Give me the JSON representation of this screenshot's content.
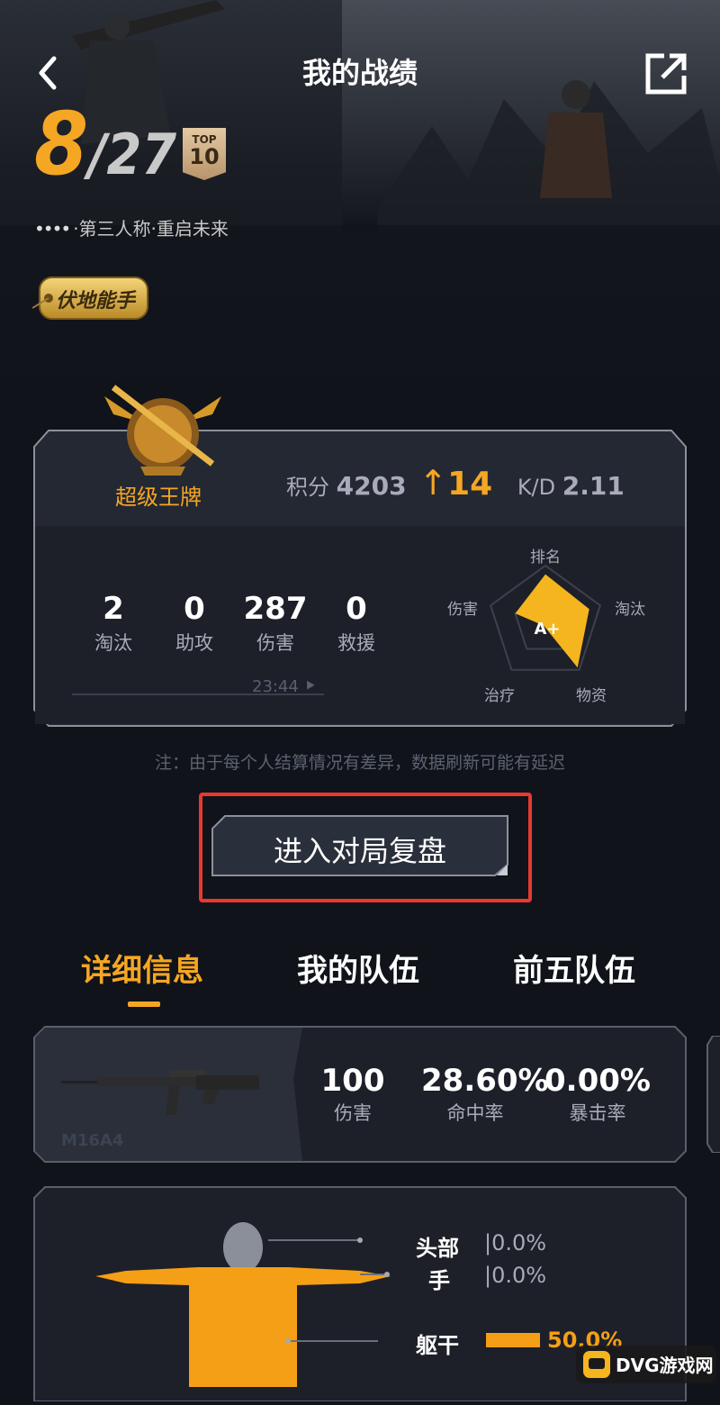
{
  "header": {
    "title": "我的战绩"
  },
  "result": {
    "rank": "8",
    "total": "/27",
    "top_badge_line1": "TOP",
    "top_badge_line2": "10"
  },
  "mode": {
    "icon": "••••",
    "text": "·第三人称·重启未来"
  },
  "title_tag": {
    "label": "伏地能手"
  },
  "tier": {
    "name": "超级王牌"
  },
  "score": {
    "label": "积分",
    "value": "4203",
    "arrow": "↑",
    "delta": "14",
    "kd_label": "K/D",
    "kd_value": "2.11"
  },
  "stats": [
    {
      "value": "2",
      "label": "淘汰"
    },
    {
      "value": "0",
      "label": "助攻"
    },
    {
      "value": "287",
      "label": "伤害"
    },
    {
      "value": "0",
      "label": "救援"
    }
  ],
  "survive_time": "23:44",
  "radar": {
    "grade": "A+",
    "labels": {
      "top": "排名",
      "right": "淘汰",
      "bottom_right": "物资",
      "bottom_left": "治疗",
      "left": "伤害"
    },
    "values": {
      "top": 0.85,
      "right": 0.8,
      "bottom_right": 0.95,
      "bottom_left": 0.05,
      "left": 0.55
    }
  },
  "note": "注：由于每个人结算情况有差异，数据刷新可能有延迟",
  "replay_button": "进入对局复盘",
  "tabs": [
    "详细信息",
    "我的队伍",
    "前五队伍"
  ],
  "weapon": {
    "name": "M16A4",
    "stats": [
      {
        "value": "100",
        "label": "伤害"
      },
      {
        "value": "28.60%",
        "label": "命中率"
      },
      {
        "value": "0.00%",
        "label": "暴击率"
      }
    ]
  },
  "body_parts": [
    {
      "name": "头部",
      "pct": "0.0%"
    },
    {
      "name": "手",
      "pct": "0.0%"
    },
    {
      "name": "躯干",
      "pct": "50.0%"
    }
  ],
  "watermark": {
    "text": "DVG游戏网"
  },
  "colors": {
    "accent": "#f5a623",
    "highlight_frame": "#e63a2e"
  }
}
